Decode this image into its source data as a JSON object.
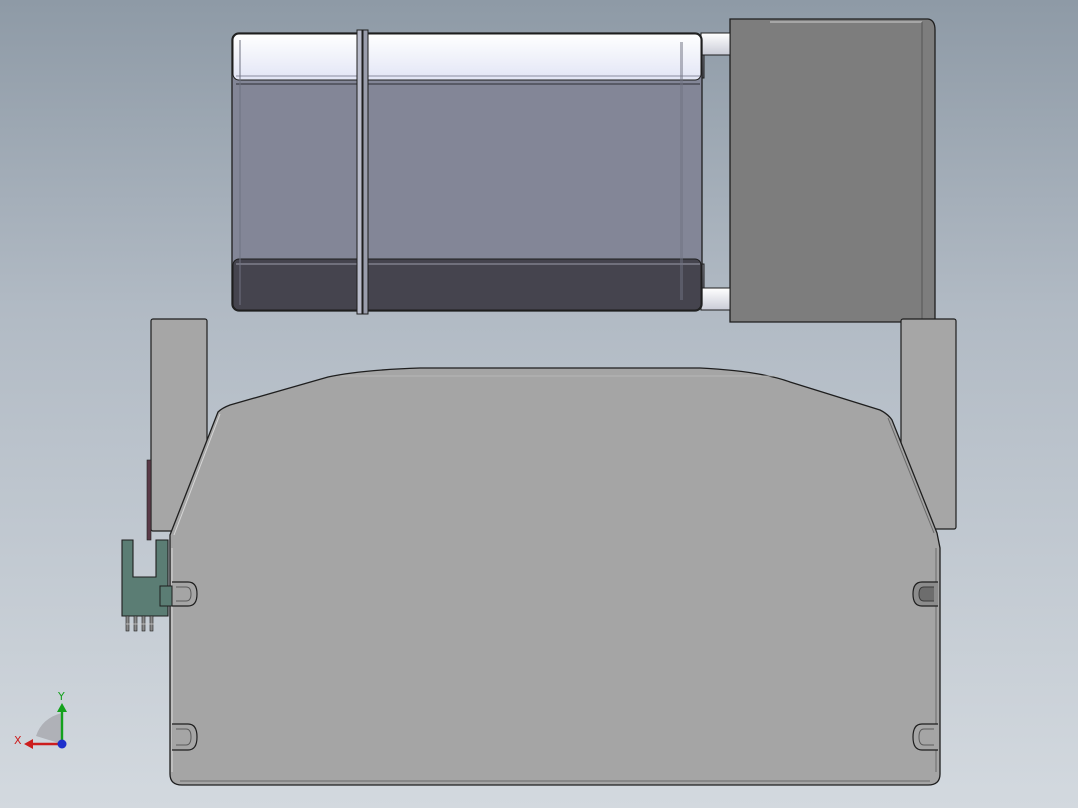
{
  "viewport": {
    "colors": {
      "background_top": "#8e9aa6",
      "background_bottom": "#d3d9df",
      "motor_body": "#838697",
      "motor_top_band": "#eef0fb",
      "motor_bottom_band": "#45444e",
      "gearbox": "#7d7d7d",
      "base_body": "#a5a5a5",
      "side_plate": "#a6a6a6",
      "sensor": "#5b7d74",
      "edge": "#1e1e1e"
    },
    "parts": {
      "motor": "stepper-motor",
      "gearbox": "gearbox-housing",
      "base": "base-block",
      "left_plate": "left-side-plate",
      "right_plate": "right-side-plate",
      "sensor": "slot-sensor"
    }
  },
  "triad": {
    "x_label": "X",
    "y_label": "Y",
    "x_color": "#cc1d1d",
    "y_color": "#14a11d",
    "z_color": "#1d2fcc"
  }
}
